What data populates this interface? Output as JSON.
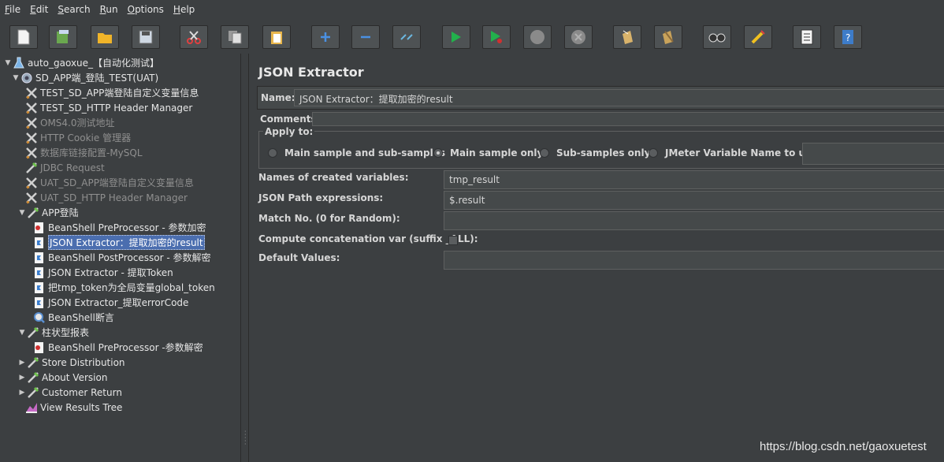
{
  "menubar": {
    "items": [
      {
        "underline": "F",
        "rest": "ile"
      },
      {
        "underline": "E",
        "rest": "dit"
      },
      {
        "underline": "S",
        "rest": "earch"
      },
      {
        "underline": "R",
        "rest": "un"
      },
      {
        "underline": "O",
        "rest": "ptions"
      },
      {
        "underline": "H",
        "rest": "elp"
      }
    ]
  },
  "toolbar": {
    "buttons": [
      "new-icon",
      "templates-icon",
      "open-icon",
      "save-icon",
      "cut-icon",
      "copy-icon",
      "paste-icon",
      "expand-icon",
      "collapse-icon",
      "toggle-icon",
      "start-icon",
      "start-no-pause-icon",
      "stop-icon",
      "shutdown-icon",
      "clear-icon",
      "clear-all-icon",
      "search-icon",
      "reset-search-icon",
      "function-helper-icon",
      "help-icon"
    ]
  },
  "tree": {
    "nodes": [
      {
        "label": "auto_gaoxue_【自动化测试】",
        "icon": "test-plan-icon",
        "toggle": "▼",
        "disabled": false
      },
      {
        "label": "SD_APP端_登陆_TEST(UAT)",
        "icon": "thread-group-icon",
        "toggle": "▼",
        "disabled": false
      },
      {
        "label": "TEST_SD_APP端登陆自定义变量信息",
        "icon": "config-element-icon",
        "toggle": "",
        "disabled": false
      },
      {
        "label": "TEST_SD_HTTP Header Manager",
        "icon": "config-element-icon",
        "toggle": "",
        "disabled": false
      },
      {
        "label": "OMS4.0测试地址",
        "icon": "config-element-icon",
        "toggle": "",
        "disabled": true
      },
      {
        "label": "HTTP Cookie 管理器",
        "icon": "config-element-icon",
        "toggle": "",
        "disabled": true
      },
      {
        "label": "数据库链接配置-MySQL",
        "icon": "config-element-icon",
        "toggle": "",
        "disabled": true
      },
      {
        "label": "JDBC Request",
        "icon": "sampler-icon",
        "toggle": "",
        "disabled": true
      },
      {
        "label": "UAT_SD_APP端登陆自定义变量信息",
        "icon": "config-element-icon",
        "toggle": "",
        "disabled": true
      },
      {
        "label": "UAT_SD_HTTP Header Manager",
        "icon": "config-element-icon",
        "toggle": "",
        "disabled": true
      },
      {
        "label": "APP登陆",
        "icon": "sampler-icon",
        "toggle": "▼",
        "disabled": false
      },
      {
        "label": "BeanShell PreProcessor - 参数加密",
        "icon": "preprocessor-icon",
        "toggle": "",
        "disabled": false
      },
      {
        "label": "JSON Extractor：提取加密的result",
        "icon": "postprocessor-icon",
        "toggle": "",
        "disabled": false,
        "selected": true
      },
      {
        "label": "BeanShell PostProcessor - 参数解密",
        "icon": "postprocessor-icon",
        "toggle": "",
        "disabled": false
      },
      {
        "label": "JSON Extractor - 提取Token",
        "icon": "postprocessor-icon",
        "toggle": "",
        "disabled": false
      },
      {
        "label": "把tmp_token为全局变量global_token",
        "icon": "postprocessor-icon",
        "toggle": "",
        "disabled": false
      },
      {
        "label": "JSON Extractor_提取errorCode",
        "icon": "postprocessor-icon",
        "toggle": "",
        "disabled": false
      },
      {
        "label": "BeanShell断言",
        "icon": "assertion-icon",
        "toggle": "",
        "disabled": false
      },
      {
        "label": "柱状型报表",
        "icon": "sampler-icon",
        "toggle": "▼",
        "disabled": false
      },
      {
        "label": "BeanShell PreProcessor -参数解密",
        "icon": "preprocessor-icon",
        "toggle": "",
        "disabled": false
      },
      {
        "label": "Store Distribution",
        "icon": "sampler-icon",
        "toggle": "▶",
        "disabled": false
      },
      {
        "label": "About Version",
        "icon": "sampler-icon",
        "toggle": "▶",
        "disabled": false
      },
      {
        "label": "Customer Return",
        "icon": "sampler-icon",
        "toggle": "▶",
        "disabled": false
      },
      {
        "label": "View Results Tree",
        "icon": "listener-icon",
        "toggle": "",
        "disabled": false
      }
    ]
  },
  "panel": {
    "title": "JSON Extractor",
    "name_label": "Name:",
    "name_value": "JSON Extractor：提取加密的result",
    "comments_label": "Comments:",
    "comments_value": "",
    "apply_to": {
      "legend": "Apply to:",
      "options": [
        "Main sample and sub-samples",
        "Main sample only",
        "Sub-samples only",
        "JMeter Variable Name to use"
      ],
      "selected_index": 1,
      "variable_value": ""
    },
    "fields": [
      {
        "label": "Names of created variables:",
        "value": "tmp_result"
      },
      {
        "label": "JSON Path expressions:",
        "value": "$.result"
      },
      {
        "label": "Match No. (0 for Random):",
        "value": ""
      },
      {
        "label": "Compute concatenation var (suffix _ALL):",
        "checkbox": true,
        "checked": false
      },
      {
        "label": "Default Values:",
        "value": ""
      }
    ]
  },
  "watermark": "https://blog.csdn.net/gaoxuetest"
}
